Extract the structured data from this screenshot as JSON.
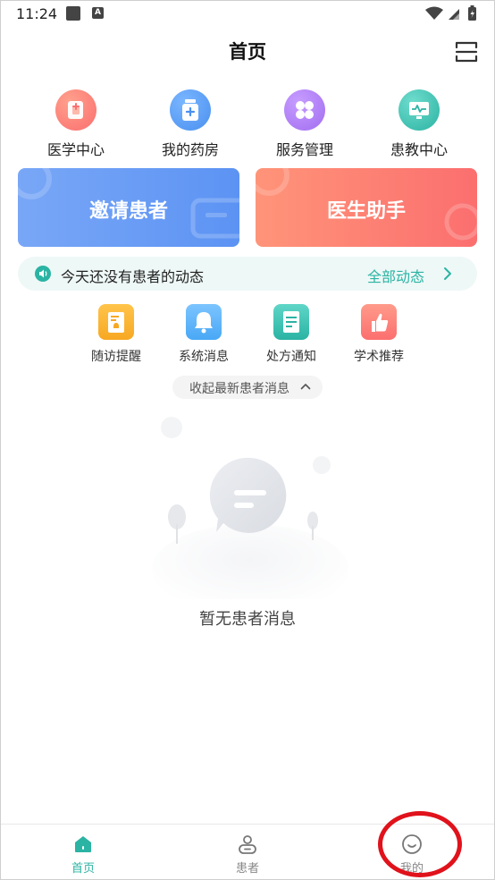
{
  "status_bar": {
    "time": "11:24",
    "notification_badge": "A"
  },
  "header": {
    "title": "首页",
    "scan_icon": "scan-icon"
  },
  "quick_nav": [
    {
      "label": "医学中心",
      "icon": "medical-center-icon",
      "color": "#fb6f6f"
    },
    {
      "label": "我的药房",
      "icon": "pharmacy-icon",
      "color": "#4a90f0"
    },
    {
      "label": "服务管理",
      "icon": "service-management-icon",
      "color": "#a26ef0"
    },
    {
      "label": "患教中心",
      "icon": "patient-education-icon",
      "color": "#2bb3a3"
    }
  ],
  "promo": {
    "invite_label": "邀请患者",
    "assistant_label": "医生助手",
    "invite_color": "#6a9ff5",
    "assistant_color": "#fd8074"
  },
  "notice": {
    "text": "今天还没有患者的动态",
    "link_label": "全部动态"
  },
  "message_categories": [
    {
      "label": "随访提醒",
      "icon": "follow-up-reminder-icon",
      "color": "#f7a823"
    },
    {
      "label": "系统消息",
      "icon": "system-message-icon",
      "color": "#49a8f5"
    },
    {
      "label": "处方通知",
      "icon": "prescription-notice-icon",
      "color": "#2bb3a3"
    },
    {
      "label": "学术推荐",
      "icon": "academic-recommend-icon",
      "color": "#fb6f6f"
    }
  ],
  "collapse_label": "收起最新患者消息",
  "empty_state": {
    "text": "暂无患者消息"
  },
  "tabbar": [
    {
      "label": "首页",
      "icon": "home-icon",
      "active": true
    },
    {
      "label": "患者",
      "icon": "patient-icon",
      "active": false
    },
    {
      "label": "我的",
      "icon": "profile-icon",
      "active": false
    }
  ],
  "colors": {
    "accent": "#2bb3a3",
    "highlight": "#e0121b"
  }
}
